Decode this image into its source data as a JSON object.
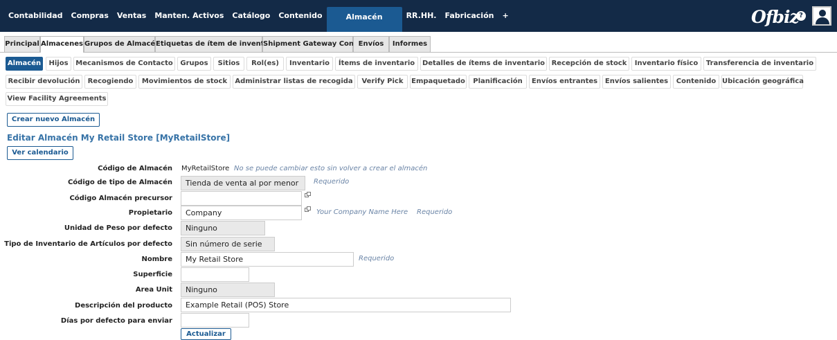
{
  "topnav": {
    "items": [
      "Contabilidad",
      "Compras",
      "Ventas",
      "Manten. Activos",
      "Catálogo",
      "Contenido",
      "Almacén",
      "RR.HH.",
      "Fabricación",
      "+"
    ],
    "active": "Almacén",
    "logo": "Ofbiz",
    "help": "?"
  },
  "subtabs": [
    "Principal",
    "Almacenes",
    "Grupos de Almacén",
    "Etiquetas de ítem de inventario",
    "Shipment Gateway Config",
    "Envíos",
    "Informes"
  ],
  "buttons_row1": [
    "Almacén",
    "Hijos",
    "Mecanismos de Contacto",
    "Grupos",
    "Sitios",
    "Rol(es)",
    "Inventario",
    "Ítems de inventario",
    "Detalles de ítems de inventario",
    "Recepción de stock",
    "Inventario físico",
    "Transferencia de inventario"
  ],
  "buttons_row2": [
    "Recibir devolución",
    "Recogiendo",
    "Movimientos de stock",
    "Administrar listas de recogida",
    "Verify Pick",
    "Empaquetado",
    "Planificación",
    "Envíos entrantes",
    "Envíos salientes",
    "Contenido",
    "Ubicación geográfica"
  ],
  "buttons_row3": [
    "View Facility Agreements"
  ],
  "create_button": "Crear nuevo Almacén",
  "section_title": "Editar Almacén My Retail Store [MyRetailStore]",
  "calendar_button": "Ver calendario",
  "form": {
    "facility_id_label": "Código de Almacén",
    "facility_id_value": "MyRetailStore",
    "facility_id_hint": "No se puede cambiar esto sin volver a crear el almacén",
    "type_label": "Código de tipo de Almacén",
    "type_value": "Tienda de venta al por menor",
    "required": "Requerido",
    "parent_label": "Código Almacén precursor",
    "parent_value": "",
    "owner_label": "Propietario",
    "owner_value": "Company",
    "owner_hint": "Your Company Name Here",
    "weight_label": "Unidad de Peso por defecto",
    "weight_value": "Ninguno",
    "inv_type_label": "Tipo de Inventario de Artículos por defecto",
    "inv_type_value": "Sin número de serie",
    "name_label": "Nombre",
    "name_value": "My Retail Store",
    "area_label": "Superficie",
    "area_value": "",
    "area_unit_label": "Area Unit",
    "area_unit_value": "Ninguno",
    "desc_label": "Descripción del producto",
    "desc_value": "Example Retail (POS) Store",
    "days_label": "Días por defecto para enviar",
    "days_value": "",
    "update_button": "Actualizar"
  }
}
